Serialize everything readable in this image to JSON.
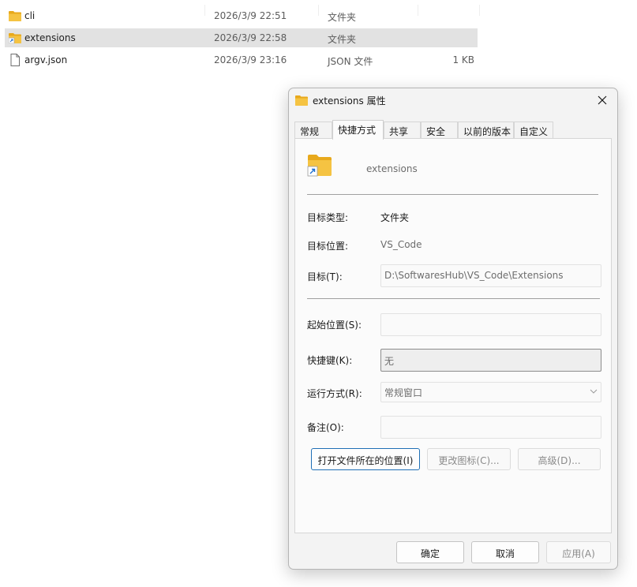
{
  "files": [
    {
      "icon": "folder-icon",
      "name": "cli",
      "date": "2026/3/9 22:51",
      "type": "文件夹",
      "size": ""
    },
    {
      "icon": "folder-shortcut-icon",
      "name": "extensions",
      "date": "2026/3/9 22:58",
      "type": "文件夹",
      "size": "",
      "selected": true
    },
    {
      "icon": "file-icon",
      "name": "argv.json",
      "date": "2026/3/9 23:16",
      "type": "JSON 文件",
      "size": "1 KB"
    }
  ],
  "dialog": {
    "title": "extensions 属性",
    "tabs": [
      "常规",
      "快捷方式",
      "共享",
      "安全",
      "以前的版本",
      "自定义"
    ],
    "active_tab": "快捷方式",
    "shortcut_name": "extensions",
    "target_type_label": "目标类型:",
    "target_type_value": "文件夹",
    "target_location_label": "目标位置:",
    "target_location_value": "VS_Code",
    "target_label": "目标(T):",
    "target_value": "D:\\SoftwaresHub\\VS_Code\\Extensions",
    "start_in_label": "起始位置(S):",
    "start_in_value": "",
    "hotkey_label": "快捷键(K):",
    "hotkey_value": "无",
    "run_label": "运行方式(R):",
    "run_value": "常规窗口",
    "comment_label": "备注(O):",
    "comment_value": "",
    "open_location_button": "打开文件所在的位置(I)",
    "change_icon_button": "更改图标(C)...",
    "advanced_button": "高级(D)...",
    "ok_button": "确定",
    "cancel_button": "取消",
    "apply_button": "应用(A)"
  },
  "colors": {
    "folder": "#f5c342",
    "folder_dark": "#e8a91c",
    "shortcut_arrow": "#1d6fd1",
    "selection": "#e2e2e2",
    "focus_border": "#1f6fb5"
  }
}
